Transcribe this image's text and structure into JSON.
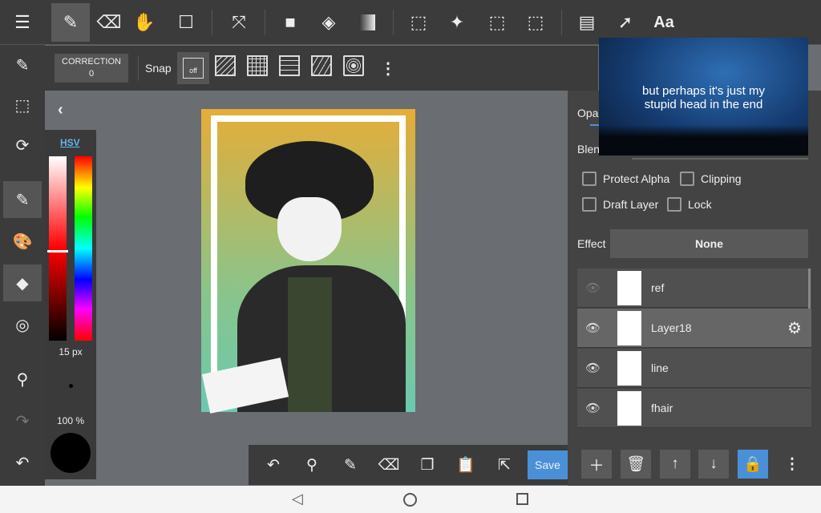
{
  "toolbar": {
    "tools": [
      "menu-icon",
      "pen-icon",
      "eraser-icon",
      "hand-icon",
      "shape-icon",
      "move-icon",
      "fill-rect-icon",
      "bucket-icon",
      "gradient-icon",
      "select-icon",
      "magic-wand-icon",
      "select-pen-icon",
      "select-eraser-icon",
      "panel-icon",
      "pointer-icon"
    ],
    "text_tool": "Aa"
  },
  "subbar": {
    "correction_label": "CORRECTION",
    "correction_value": "0",
    "snap_label": "Snap",
    "snap_off": "off"
  },
  "color_panel": {
    "mode": "HSV",
    "brush_size": "15 px",
    "opacity": "100 %",
    "color": "#000000"
  },
  "layer_props": {
    "opacity_label": "Opa",
    "blend_label": "Blen",
    "protect_alpha": "Protect Alpha",
    "clipping": "Clipping",
    "draft_layer": "Draft Layer",
    "lock": "Lock",
    "effect_label": "Effect",
    "effect_value": "None"
  },
  "layers": [
    {
      "name": "ref",
      "visible": true
    },
    {
      "name": "Layer18",
      "visible": true,
      "selected": true
    },
    {
      "name": "line",
      "visible": true
    },
    {
      "name": "fhair",
      "visible": true
    }
  ],
  "bottom": {
    "save_label": "Save"
  },
  "overlay": {
    "caption_line1": "but perhaps it's just my",
    "caption_line2": "stupid head in the end"
  },
  "accent": "#4a90d9"
}
